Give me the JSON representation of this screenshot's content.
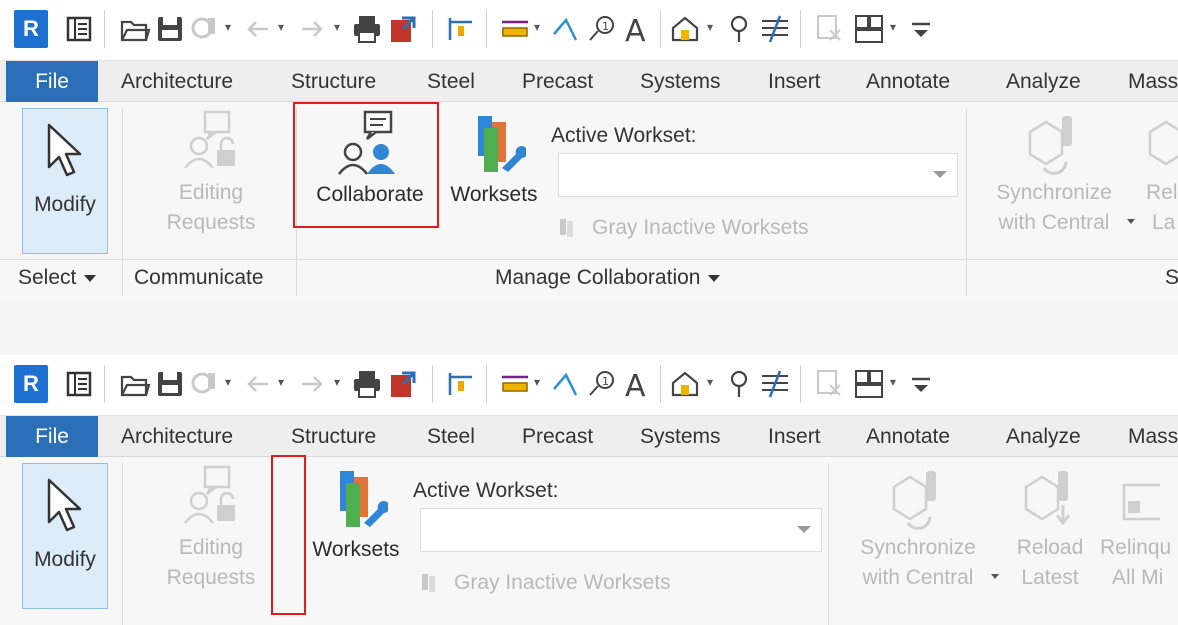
{
  "app": {
    "logo_letter": "R"
  },
  "tabs": [
    "File",
    "Architecture",
    "Structure",
    "Steel",
    "Precast",
    "Systems",
    "Insert",
    "Annotate",
    "Analyze",
    "Mass"
  ],
  "ribbon": {
    "modify_label": "Modify",
    "select_panel": "Select",
    "communicate_panel": "Communicate",
    "editing_requests": [
      "Editing",
      "Requests"
    ],
    "collaborate_label": "Collaborate",
    "worksets_label": "Worksets",
    "active_workset_label": "Active Workset:",
    "active_workset_value": "",
    "gray_inactive_label": "Gray Inactive Worksets",
    "manage_collab_panel": "Manage Collaboration",
    "sync_label": [
      "Synchronize",
      "with Central"
    ],
    "reload_latest": [
      "Reload",
      "Latest"
    ],
    "relinquish_top": [
      "Rel",
      "La"
    ],
    "relinquish_bottom": [
      "Relinqu",
      "All Mi"
    ],
    "sync_panel_cut": "S"
  },
  "colors": {
    "file_tab": "#2a6fb7",
    "highlight_box": "#e01b1b",
    "modify_active_bg": "#dcecf8"
  },
  "icons": [
    "revit-logo",
    "project-browser-icon",
    "open-icon",
    "save-icon",
    "sync-icon",
    "undo-icon",
    "redo-icon",
    "print-icon",
    "export-icon",
    "align-dimension-icon",
    "measure-icon",
    "angular-icon",
    "tag-icon",
    "text-icon",
    "3d-view-icon",
    "section-icon",
    "thin-lines-icon",
    "close-windows-icon",
    "switch-windows-icon",
    "customize-qat-icon",
    "modify-cursor-icon",
    "editing-requests-icon",
    "collaborate-icon",
    "worksets-icon",
    "synchronize-icon",
    "reload-latest-icon",
    "relinquish-icon"
  ]
}
